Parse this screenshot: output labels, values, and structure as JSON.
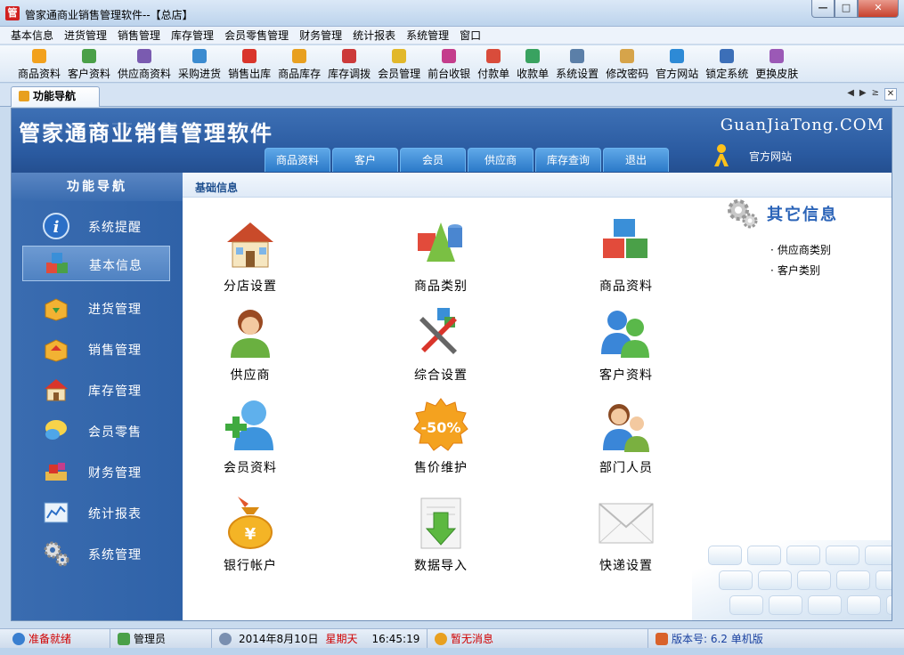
{
  "window": {
    "title": "管家通商业销售管理软件--【总店】",
    "app_icon": "管"
  },
  "menu": [
    "基本信息",
    "进货管理",
    "销售管理",
    "库存管理",
    "会员零售管理",
    "财务管理",
    "统计报表",
    "系统管理",
    "窗口"
  ],
  "toolbar": [
    {
      "label": "商品资料",
      "icon": "goods-icon",
      "color": "#f2a11d"
    },
    {
      "label": "客户资料",
      "icon": "customer-icon",
      "color": "#4aa048"
    },
    {
      "label": "供应商资料",
      "icon": "supplier-icon",
      "color": "#7a5bb0"
    },
    {
      "label": "采购进货",
      "icon": "purchase-icon",
      "color": "#3b8bd0"
    },
    {
      "label": "销售出库",
      "icon": "sales-icon",
      "color": "#d9352b"
    },
    {
      "label": "商品库存",
      "icon": "stock-icon",
      "color": "#e8a020"
    },
    {
      "label": "库存调拨",
      "icon": "transfer-icon",
      "color": "#cc3a3a"
    },
    {
      "label": "会员管理",
      "icon": "member-icon",
      "color": "#e2b82a"
    },
    {
      "label": "前台收银",
      "icon": "cashier-icon",
      "color": "#c43d8c"
    },
    {
      "label": "付款单",
      "icon": "payment-icon",
      "color": "#d94c3b"
    },
    {
      "label": "收款单",
      "icon": "receipt-icon",
      "color": "#39a260"
    },
    {
      "label": "系统设置",
      "icon": "settings-icon",
      "color": "#5b7fa8"
    },
    {
      "label": "修改密码",
      "icon": "password-icon",
      "color": "#d6a44a"
    },
    {
      "label": "官方网站",
      "icon": "website-icon",
      "color": "#2d8ad6"
    },
    {
      "label": "锁定系统",
      "icon": "lock-icon",
      "color": "#3c6fb8"
    },
    {
      "label": "更换皮肤",
      "icon": "skin-icon",
      "color": "#9b59b6"
    }
  ],
  "tab": {
    "label": "功能导航"
  },
  "banner": {
    "brand": "管家通商业销售管理软件",
    "url": "GuanJiaTong.COM",
    "tabs": [
      "商品资料",
      "客户",
      "会员",
      "供应商",
      "库存查询",
      "退出"
    ],
    "site_label": "官方网站"
  },
  "sidebar": {
    "heading": "功能导航",
    "items": [
      {
        "label": "系统提醒",
        "icon": "info-icon"
      },
      {
        "label": "基本信息",
        "icon": "cubes-icon",
        "active": true
      },
      {
        "label": "进货管理",
        "icon": "box-in-icon"
      },
      {
        "label": "销售管理",
        "icon": "box-out-icon"
      },
      {
        "label": "库存管理",
        "icon": "warehouse-icon"
      },
      {
        "label": "会员零售",
        "icon": "chat-bubble-icon"
      },
      {
        "label": "财务管理",
        "icon": "finance-icon"
      },
      {
        "label": "统计报表",
        "icon": "report-chart-icon"
      },
      {
        "label": "系统管理",
        "icon": "gears-icon"
      }
    ]
  },
  "content": {
    "heading": "基础信息",
    "cells": [
      {
        "label": "分店设置",
        "icon": "house-icon"
      },
      {
        "label": "商品类别",
        "icon": "shapes-icon"
      },
      {
        "label": "商品资料",
        "icon": "blocks-icon"
      },
      {
        "label": "供应商",
        "icon": "person-icon"
      },
      {
        "label": "综合设置",
        "icon": "tools-icon"
      },
      {
        "label": "客户资料",
        "icon": "users-icon"
      },
      {
        "label": "会员资料",
        "icon": "add-user-icon"
      },
      {
        "label": "售价维护",
        "icon": "discount-badge-icon",
        "badge": "-50%"
      },
      {
        "label": "部门人员",
        "icon": "staff-icon"
      },
      {
        "label": "银行帐户",
        "icon": "money-bag-icon",
        "badge": "¥"
      },
      {
        "label": "数据导入",
        "icon": "import-icon"
      },
      {
        "label": "快递设置",
        "icon": "envelope-icon"
      }
    ],
    "other": {
      "title": "其它信息",
      "links": [
        "供应商类别",
        "客户类别"
      ]
    }
  },
  "status": {
    "ready": "准备就绪",
    "user": "管理员",
    "date": "2014年8月10日",
    "weekday": "星期天",
    "time": "16:45:19",
    "messages": "暂无消息",
    "version": "版本号: 6.2 单机版"
  }
}
